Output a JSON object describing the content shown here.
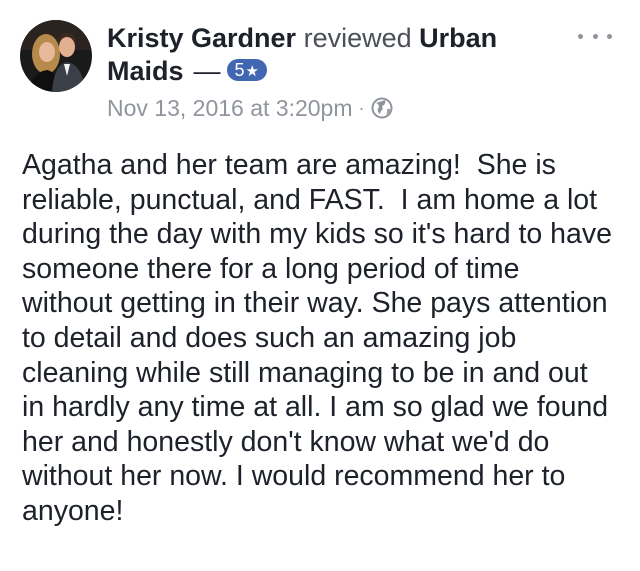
{
  "post": {
    "author_name": "Kristy Gardner",
    "verb": "reviewed",
    "page_name": "Urban Maids",
    "page_name_line1": "Urban",
    "page_name_line2": "Maids",
    "separator": "—",
    "rating": {
      "value": "5",
      "star_icon": "★",
      "color": "#4267b2"
    },
    "timestamp": "Nov 13, 2016 at 3:20pm",
    "meta_separator": "·",
    "privacy_icon": "globe-icon",
    "more_icon": "more-options-icon",
    "review_lines": [
      "Agatha and her team are amazing!  She is",
      "reliable, punctual, and FAST.  I am home a lot",
      "during the day with my kids so it's hard to have",
      "someone there for a long period of time",
      "without getting in their way. She pays attention",
      "to detail and does such an amazing job",
      "cleaning while still managing to be in and out",
      "in hardly any time at all. I am so glad we found",
      "her and honestly don't know what we'd do",
      "without her now. I would recommend her to",
      "anyone!"
    ]
  }
}
